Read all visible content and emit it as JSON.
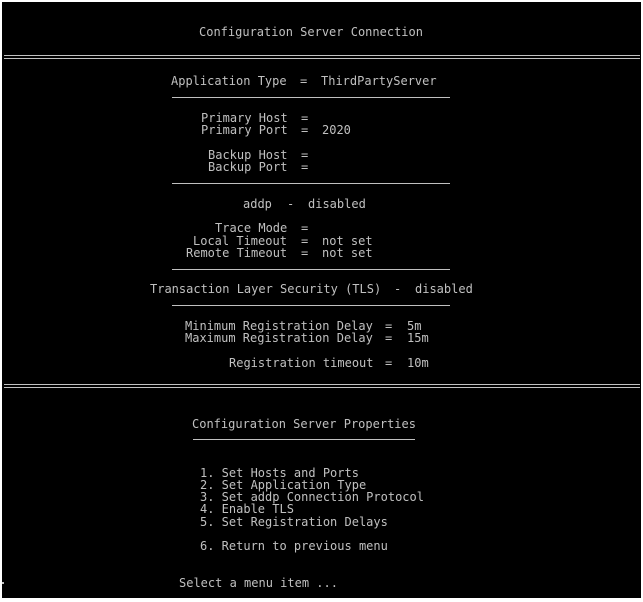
{
  "title": "Configuration Server Connection",
  "application": {
    "label": "Application Type",
    "value": "ThirdPartyServer"
  },
  "primary": {
    "host_label": "Primary Host",
    "host_value": "",
    "port_label": "Primary Port",
    "port_value": "2020"
  },
  "backup": {
    "host_label": "Backup Host",
    "host_value": "",
    "port_label": "Backup Port",
    "port_value": ""
  },
  "addp": {
    "label": "addp",
    "status": "disabled",
    "trace_label": "Trace Mode",
    "trace_value": "",
    "local_label": "Local Timeout",
    "local_value": "not set",
    "remote_label": "Remote Timeout",
    "remote_value": "not set"
  },
  "tls": {
    "label": "Transaction Layer Security (TLS)",
    "status": "disabled"
  },
  "registration": {
    "min_label": "Minimum Registration Delay",
    "min_value": "5m",
    "max_label": "Maximum Registration Delay",
    "max_value": "15m",
    "timeout_label": "Registration timeout",
    "timeout_value": "10m"
  },
  "properties_title": "Configuration Server Properties",
  "menu": {
    "items": [
      "1. Set Hosts and Ports",
      "2. Set Application Type",
      "3. Set addp Connection Protocol",
      "4. Enable TLS",
      "5. Set Registration Delays"
    ],
    "return_item": "6. Return to previous menu"
  },
  "prompt": "Select a menu item ...",
  "symbols": {
    "eq": "=",
    "dash": "-"
  },
  "colors": {
    "background": "#000000",
    "text": "#c0c0c0"
  }
}
